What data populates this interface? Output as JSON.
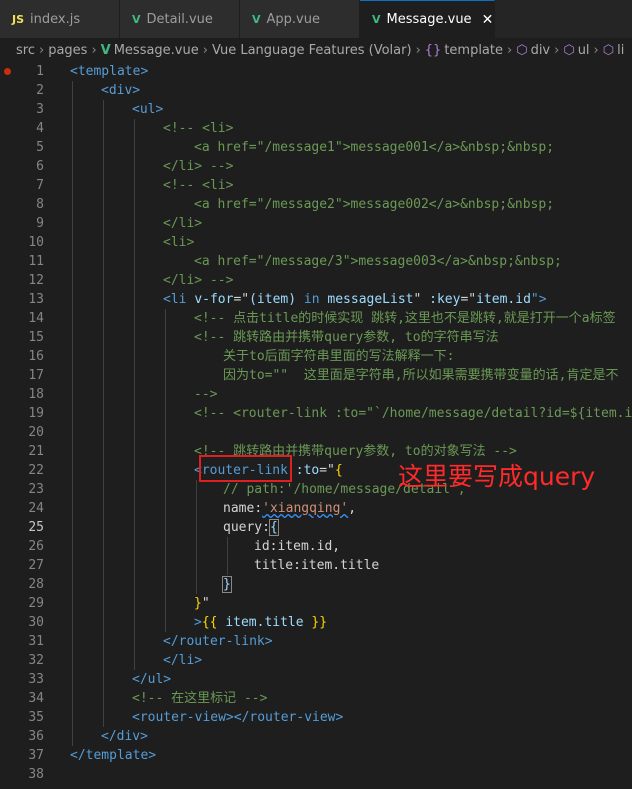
{
  "tabs": [
    {
      "icon": "JS",
      "label": "index.js",
      "active": false
    },
    {
      "icon": "V",
      "label": "Detail.vue",
      "active": false
    },
    {
      "icon": "V",
      "label": "App.vue",
      "active": false
    },
    {
      "icon": "V",
      "label": "Message.vue",
      "active": true,
      "close": "✕"
    }
  ],
  "breadcrumb": {
    "src": "src",
    "pages": "pages",
    "file": "Message.vue",
    "volar": "Vue Language Features (Volar)",
    "template": "template",
    "div": "div",
    "ul": "ul",
    "li": "li"
  },
  "line_numbers": [
    "1",
    "2",
    "3",
    "4",
    "5",
    "6",
    "7",
    "8",
    "9",
    "10",
    "11",
    "12",
    "13",
    "14",
    "15",
    "16",
    "17",
    "18",
    "19",
    "20",
    "21",
    "22",
    "23",
    "24",
    "25",
    "26",
    "27",
    "28",
    "29",
    "30",
    "31",
    "32",
    "33",
    "34",
    "35",
    "36",
    "37",
    "38"
  ],
  "code": {
    "l1": "<template>",
    "l2": "<div>",
    "l3": "<ul>",
    "l4": "<!-- <li>",
    "l5a": "<a href=\"/message1\">message001</a>",
    "l5b": "&nbsp;&nbsp;",
    "l6": "</li> -->",
    "l7": "<!-- <li>",
    "l8a": "<a href=\"/message2\">message002</a>",
    "l8b": "&nbsp;&nbsp;",
    "l9": "</li>",
    "l10": "<li>",
    "l11a": "<a href=\"/message/3\">message003</a>",
    "l11b": "&nbsp;&nbsp;",
    "l12": "</li> -->",
    "l13_open": "<li",
    "l13_vfor": "v-for",
    "l13_eq": "=\"",
    "l13_item": "(item)",
    "l13_in": "in",
    "l13_list": "messageList",
    "l13_q": "\"",
    "l13_key": ":key",
    "l13_eq2": "=\"",
    "l13_itemid": "item.id",
    "l13_end": "\">",
    "l14": "<!-- 点击title的时候实现 跳转,这里也不是跳转,就是打开一个a标签",
    "l15": "<!-- 跳转路由并携带query参数, to的字符串写法",
    "l16": "关于to后面字符串里面的写法解释一下:",
    "l17": "因为to=\"\"  这里面是字符串,所以如果需要携带变量的话,肯定是不",
    "l18": "-->",
    "l19": "<!-- <router-link :to=\"`/home/message/detail?id=${item.id}",
    "l20": "",
    "l21": "<!-- 跳转路由并携带query参数, to的对象写法 -->",
    "l22_open": "<router-link",
    "l22_to": ":to",
    "l22_eq": "=\"",
    "l22_brace": "{",
    "l23": "// path:'/home/message/detail',",
    "l24_key": "name",
    "l24_colon": ":",
    "l24_val": "'xiangqing'",
    "l24_comma": ",",
    "l25_key": "query",
    "l25_colon": ":",
    "l25_brace": "{",
    "l26": "id:item.id,",
    "l26_key": "id",
    "l26_val": "item.id",
    "l27_key": "title",
    "l27_val": "item.title",
    "l28": "}",
    "l29_brace": "}",
    "l29_q": "\"",
    "l30_gt": ">",
    "l30_mus": "{{",
    "l30_expr": "item.title",
    "l30_mus2": "}}",
    "l31": "</router-link>",
    "l32": "</li>",
    "l33": "</ul>",
    "l34": "<!-- 在这里标记 -->",
    "l35a": "<router-view>",
    "l35b": "</router-view>",
    "l36": "</div>",
    "l37": "</template>",
    "l38": ""
  },
  "annotation": {
    "text": "这里要写成query"
  },
  "colors": {
    "tag": "#569cd6",
    "attribute": "#9cdcfe",
    "string": "#ce9178",
    "comment": "#6a9955",
    "annotation": "#ff2a2a",
    "vue_icon": "#41b883",
    "js_icon": "#f1e05a"
  }
}
